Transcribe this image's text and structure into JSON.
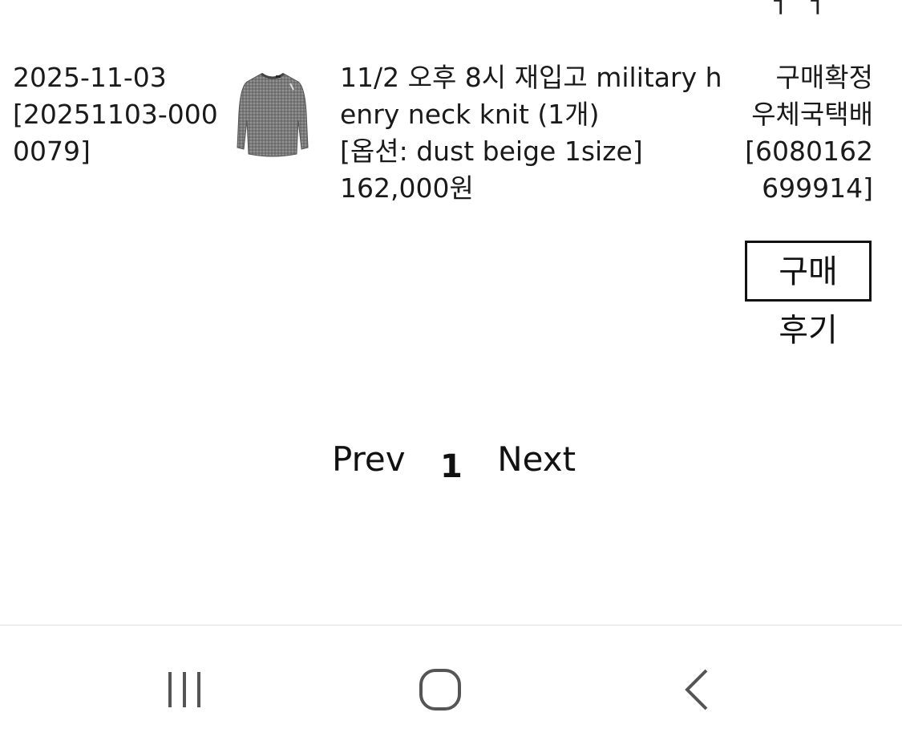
{
  "top_clip": "ㅓ ㅓ",
  "order": {
    "date": "2025-11-03",
    "order_number": "[20251103-0000079]",
    "product_title": "11/2 오후 8시 재입고 military henry neck knit (1개)",
    "option": "[옵션: dust beige 1size]",
    "price": "162,000원",
    "status": "구매확정",
    "courier": "우체국택배",
    "tracking": "[6080162699914]",
    "review_label_line1": "구매",
    "review_label_line2": "후기",
    "thumbnail_icon": "knit-sweater-image"
  },
  "pagination": {
    "prev": "Prev",
    "current": "1",
    "next": "Next"
  },
  "nav": {
    "recents_icon": "recent-apps-icon",
    "home_icon": "home-icon",
    "back_icon": "back-icon"
  }
}
